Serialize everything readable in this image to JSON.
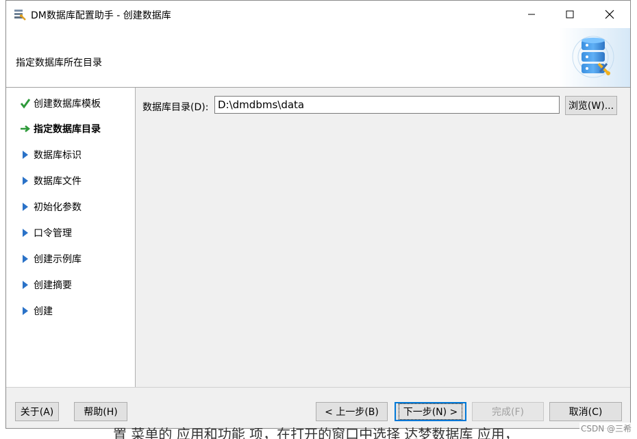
{
  "window": {
    "title": "DM数据库配置助手 - 创建数据库",
    "minimize_icon": "minimize-icon",
    "maximize_icon": "maximize-icon",
    "close_icon": "close-icon"
  },
  "header": {
    "subtitle": "指定数据库所在目录",
    "graphic_icon": "database-config-icon"
  },
  "steps": [
    {
      "label": "创建数据库模板",
      "status": "done",
      "icon": "check-icon"
    },
    {
      "label": "指定数据库目录",
      "status": "current",
      "icon": "arrow-right-icon"
    },
    {
      "label": "数据库标识",
      "status": "pending",
      "icon": "triangle-right-icon"
    },
    {
      "label": "数据库文件",
      "status": "pending",
      "icon": "triangle-right-icon"
    },
    {
      "label": "初始化参数",
      "status": "pending",
      "icon": "triangle-right-icon"
    },
    {
      "label": "口令管理",
      "status": "pending",
      "icon": "triangle-right-icon"
    },
    {
      "label": "创建示例库",
      "status": "pending",
      "icon": "triangle-right-icon"
    },
    {
      "label": "创建摘要",
      "status": "pending",
      "icon": "triangle-right-icon"
    },
    {
      "label": "创建",
      "status": "pending",
      "icon": "triangle-right-icon"
    }
  ],
  "main": {
    "dir_label": "数据库目录(D):",
    "dir_value": "D:\\dmdbms\\data",
    "browse_label": "浏览(W)..."
  },
  "footer": {
    "about_label": "关于(A)",
    "help_label": "帮助(H)",
    "prev_label": "< 上一步(B)",
    "next_label": "下一步(N) >",
    "finish_label": "完成(F)",
    "cancel_label": "取消(C)"
  },
  "background_text": "置 菜单的 应用和功能 项，在打开的窗口中选择 达梦数据库 应用，",
  "watermark": "CSDN @三希",
  "colors": {
    "check": "#2e9a3a",
    "current_arrow": "#2e9a3a",
    "pending_arrow": "#2a72c8",
    "accent": "#0078d7"
  }
}
